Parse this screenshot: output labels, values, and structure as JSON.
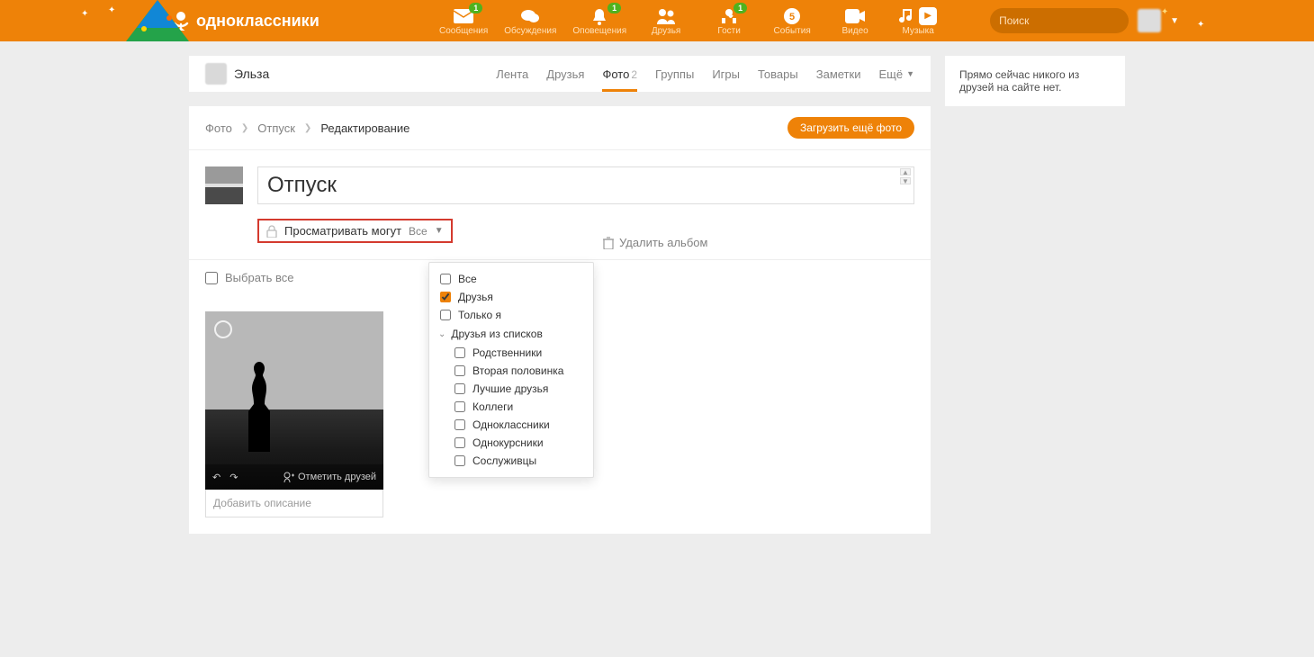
{
  "brand": "одноклассники",
  "nav": [
    {
      "label": "Сообщения",
      "icon": "mail",
      "badge": "1"
    },
    {
      "label": "Обсуждения",
      "icon": "chat",
      "badge": null
    },
    {
      "label": "Оповещения",
      "icon": "bell",
      "badge": "1"
    },
    {
      "label": "Друзья",
      "icon": "friends",
      "badge": null
    },
    {
      "label": "Гости",
      "icon": "guests",
      "badge": "1"
    },
    {
      "label": "События",
      "icon": "events",
      "badge": null
    },
    {
      "label": "Видео",
      "icon": "video",
      "badge": null
    },
    {
      "label": "Музыка",
      "icon": "music",
      "badge": null
    }
  ],
  "search_placeholder": "Поиск",
  "profile_name": "Эльза",
  "tabs": [
    {
      "label": "Лента"
    },
    {
      "label": "Друзья"
    },
    {
      "label": "Фото",
      "count": "2",
      "active": true
    },
    {
      "label": "Группы"
    },
    {
      "label": "Игры"
    },
    {
      "label": "Товары"
    },
    {
      "label": "Заметки"
    }
  ],
  "more_label": "Ещё",
  "breadcrumb": {
    "root": "Фото",
    "album": "Отпуск",
    "current": "Редактирование"
  },
  "upload_more": "Загрузить ещё фото",
  "album_title": "Отпуск",
  "visibility": {
    "label": "Просматривать могут",
    "value": "Все"
  },
  "delete_album": "Удалить альбом",
  "options": {
    "all": "Все",
    "friends": "Друзья",
    "only_me": "Только я",
    "lists_header": "Друзья из списков",
    "lists": [
      "Родственники",
      "Вторая половинка",
      "Лучшие друзья",
      "Коллеги",
      "Одноклассники",
      "Однокурсники",
      "Сослуживцы"
    ],
    "checked": "Друзья"
  },
  "select_all": "Выбрать все",
  "tag_friends": "Отметить друзей",
  "photo_desc_placeholder": "Добавить описание",
  "sidebar_empty": "Прямо сейчас никого из друзей на сайте нет."
}
